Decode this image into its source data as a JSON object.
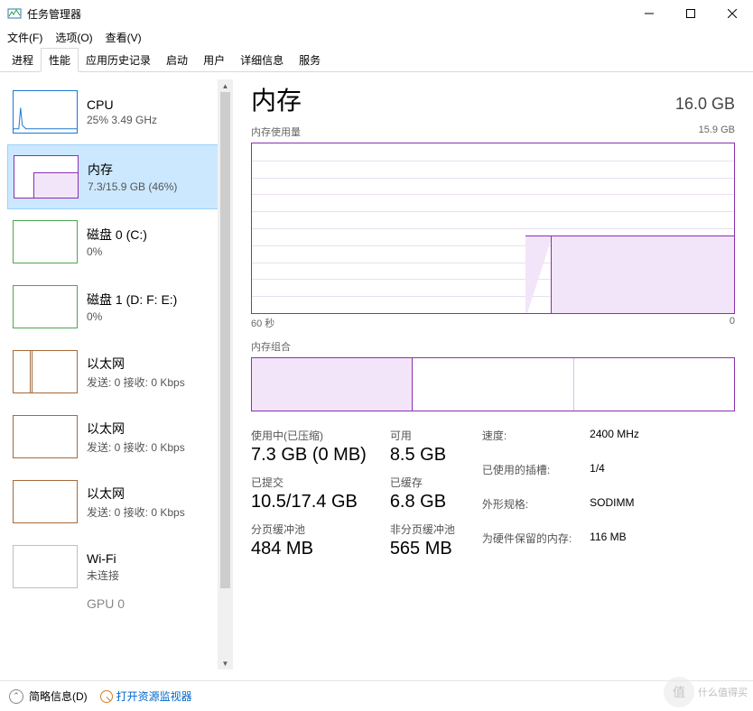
{
  "window": {
    "title": "任务管理器"
  },
  "menu": {
    "file": "文件(F)",
    "options": "选项(O)",
    "view": "查看(V)"
  },
  "tabs": [
    {
      "label": "进程"
    },
    {
      "label": "性能"
    },
    {
      "label": "应用历史记录"
    },
    {
      "label": "启动"
    },
    {
      "label": "用户"
    },
    {
      "label": "详细信息"
    },
    {
      "label": "服务"
    }
  ],
  "sidebar": {
    "items": [
      {
        "title": "CPU",
        "sub": "25% 3.49 GHz"
      },
      {
        "title": "内存",
        "sub": "7.3/15.9 GB (46%)"
      },
      {
        "title": "磁盘 0 (C:)",
        "sub": "0%"
      },
      {
        "title": "磁盘 1 (D: F: E:)",
        "sub": "0%"
      },
      {
        "title": "以太网",
        "sub": "发送: 0 接收: 0 Kbps"
      },
      {
        "title": "以太网",
        "sub": "发送: 0 接收: 0 Kbps"
      },
      {
        "title": "以太网",
        "sub": "发送: 0 接收: 0 Kbps"
      },
      {
        "title": "Wi-Fi",
        "sub": "未连接"
      },
      {
        "title": "GPU 0",
        "sub": ""
      }
    ]
  },
  "details": {
    "title": "内存",
    "total": "16.0 GB",
    "usage_label": "内存使用量",
    "usage_max": "15.9 GB",
    "xaxis_left": "60 秒",
    "xaxis_right": "0",
    "slots_label": "内存组合",
    "stats": {
      "in_use_label": "使用中(已压缩)",
      "in_use_value": "7.3 GB (0 MB)",
      "available_label": "可用",
      "available_value": "8.5 GB",
      "committed_label": "已提交",
      "committed_value": "10.5/17.4 GB",
      "cached_label": "已缓存",
      "cached_value": "6.8 GB",
      "paged_label": "分页缓冲池",
      "paged_value": "484 MB",
      "nonpaged_label": "非分页缓冲池",
      "nonpaged_value": "565 MB"
    },
    "spec": {
      "speed_k": "速度:",
      "speed_v": "2400 MHz",
      "slots_k": "已使用的插槽:",
      "slots_v": "1/4",
      "form_k": "外形规格:",
      "form_v": "SODIMM",
      "reserved_k": "为硬件保留的内存:",
      "reserved_v": "116 MB"
    }
  },
  "footer": {
    "fewer": "简略信息(D)",
    "resmon": "打开资源监视器"
  },
  "watermark": {
    "badge": "值",
    "text": "什么值得买"
  },
  "chart_data": {
    "type": "area",
    "title": "内存使用量",
    "xlabel": "60 秒 → 0",
    "ylabel": "GB",
    "ylim": [
      0,
      15.9
    ],
    "x": [
      60,
      55,
      50,
      45,
      40,
      35,
      30,
      25,
      20,
      15,
      10,
      5,
      0
    ],
    "values": [
      0,
      0,
      0,
      0,
      0,
      0,
      0,
      0,
      7.3,
      7.3,
      7.3,
      7.3,
      7.3
    ]
  }
}
